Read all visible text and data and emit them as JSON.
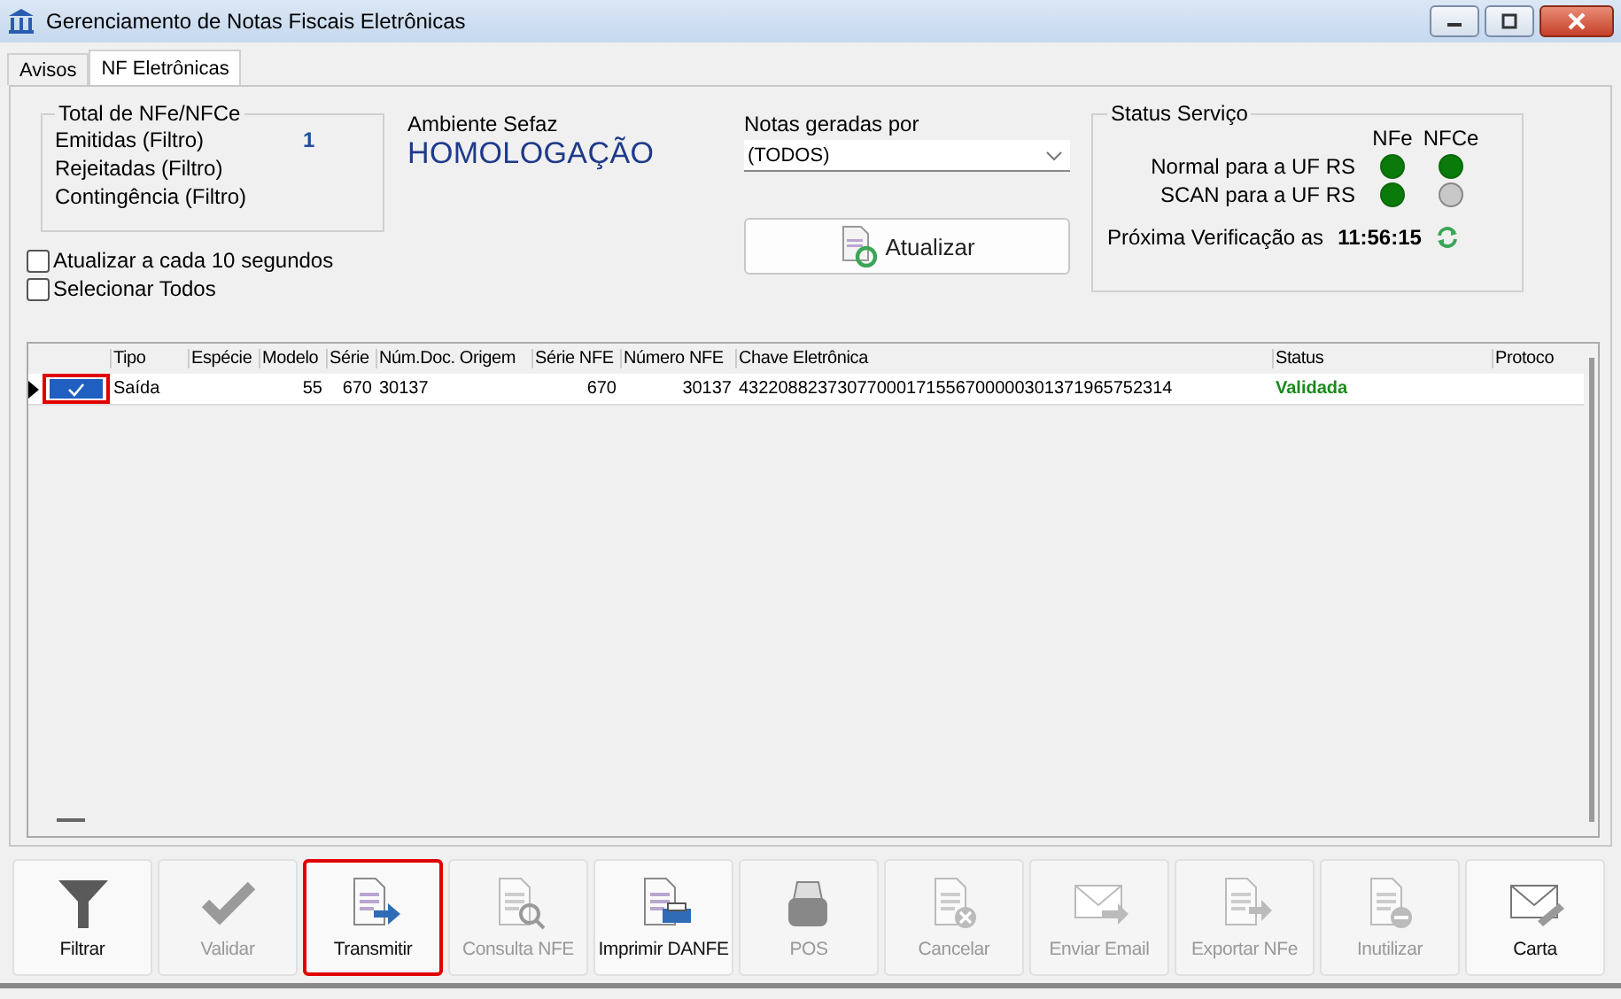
{
  "window": {
    "title": "Gerenciamento de Notas Fiscais Eletrônicas"
  },
  "tabs": [
    {
      "label": "Avisos",
      "selected": false
    },
    {
      "label": "NF Eletrônicas",
      "selected": true
    }
  ],
  "totals": {
    "title": "Total de NFe/NFCe",
    "rows": [
      {
        "label": "Emitidas (Filtro)",
        "value": "1"
      },
      {
        "label": "Rejeitadas (Filtro)"
      },
      {
        "label": "Contingência (Filtro)"
      }
    ]
  },
  "ambiente": {
    "label": "Ambiente Sefaz",
    "value": "HOMOLOGAÇÃO"
  },
  "notas_geradas_por": {
    "label": "Notas geradas por",
    "value": "(TODOS)"
  },
  "options": [
    {
      "label": "Atualizar a cada 10 segundos",
      "checked": false
    },
    {
      "label": "Selecionar Todos",
      "checked": false
    }
  ],
  "refresh_button": {
    "label": "Atualizar"
  },
  "status_servico": {
    "title": "Status Serviço",
    "columns": [
      "NFe",
      "NFCe"
    ],
    "rows": [
      {
        "label": "Normal para a UF RS",
        "lights": [
          {
            "on": true
          },
          {
            "on": true
          }
        ]
      },
      {
        "label": "SCAN para a UF RS",
        "lights": [
          {
            "on": true
          },
          {
            "on": false
          }
        ]
      }
    ],
    "next_check_label": "Próxima Verificação as",
    "next_check_time": "11:56:15"
  },
  "table": {
    "columns": [
      "Tipo",
      "Espécie",
      "Modelo",
      "Série",
      "Núm.Doc. Origem",
      "Série NFE",
      "Número NFE",
      "Chave Eletrônica",
      "Status",
      "Protoco"
    ],
    "rows": [
      {
        "checked": true,
        "highlighted": true,
        "selected": true,
        "cells": [
          "Saída",
          "",
          "55",
          "670",
          "30137",
          "670",
          "30137",
          "43220882373077000171556700000301371965752314",
          "Validada"
        ]
      }
    ]
  },
  "toolbar": [
    {
      "label": "Filtrar",
      "disabled": false,
      "highlighted": false
    },
    {
      "label": "Validar",
      "disabled": true,
      "highlighted": false
    },
    {
      "label": "Transmitir",
      "disabled": false,
      "highlighted": true
    },
    {
      "label": "Consulta NFE",
      "disabled": true,
      "highlighted": false
    },
    {
      "label": "Imprimir DANFE",
      "disabled": false,
      "highlighted": false
    },
    {
      "label": "POS",
      "disabled": true,
      "highlighted": false
    },
    {
      "label": "Cancelar",
      "disabled": true,
      "highlighted": false
    },
    {
      "label": "Enviar Email",
      "disabled": true,
      "highlighted": false
    },
    {
      "label": "Exportar NFe",
      "disabled": true,
      "highlighted": false
    },
    {
      "label": "Inutilizar",
      "disabled": true,
      "highlighted": false
    },
    {
      "label": "Carta",
      "disabled": false,
      "highlighted": false
    }
  ]
}
